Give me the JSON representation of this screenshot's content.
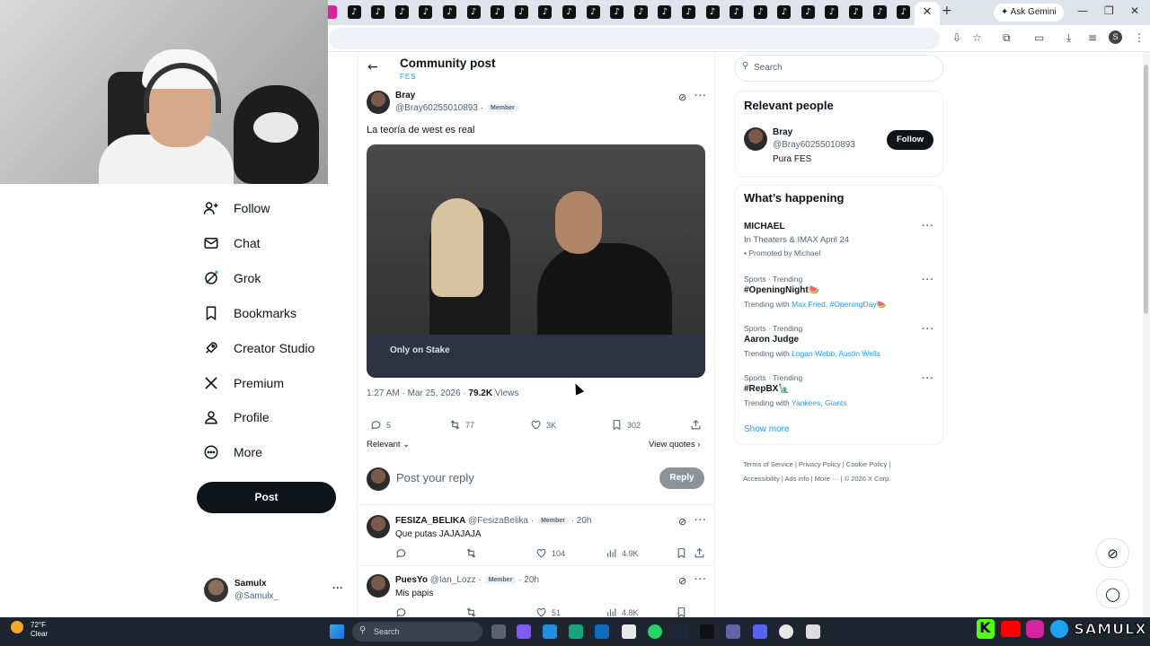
{
  "browser": {
    "gemini_label": "✦ Ask Gemini",
    "profile_initial": "S"
  },
  "sidebar": {
    "items": [
      {
        "label": "Follow",
        "icon": "follow-icon"
      },
      {
        "label": "Chat",
        "icon": "mail-icon"
      },
      {
        "label": "Grok",
        "icon": "grok-icon"
      },
      {
        "label": "Bookmarks",
        "icon": "bookmark-icon"
      },
      {
        "label": "Creator Studio",
        "icon": "rocket-icon"
      },
      {
        "label": "Premium",
        "icon": "x-logo-icon"
      },
      {
        "label": "Profile",
        "icon": "person-icon"
      },
      {
        "label": "More",
        "icon": "more-circle-icon"
      }
    ],
    "post_label": "Post",
    "account": {
      "name": "Samulx",
      "handle": "@Samulx_"
    }
  },
  "header": {
    "title": "Community post",
    "subtitle": "FES"
  },
  "post": {
    "author": "Bray",
    "handle": "@Bray60255010893 ·",
    "badge": "Member",
    "text": "La teoría de west es real",
    "media_label": "Only on Stake",
    "time": "1:27 AM · Mar 25, 2026 · ",
    "views_count": "79.2K",
    "views_label": " Views",
    "replies": "5",
    "reposts": "77",
    "likes": "3K",
    "bookmarks": "302",
    "sort_label": "Relevant",
    "quotes_label": "View quotes"
  },
  "reply_box": {
    "placeholder": "Post your reply",
    "button": "Reply"
  },
  "replies": [
    {
      "name": "FESIZA_BELIKA",
      "handle": "@FesizaBelika ·",
      "badge": "Member",
      "time": "· 20h",
      "text": "Que putas JAJAJAJA",
      "likes": "104",
      "views": "4.9K"
    },
    {
      "name": "PuesYo",
      "handle": "@Ian_Lozz ·",
      "badge": "Member",
      "time": "· 20h",
      "text": "Mis papis",
      "likes": "51",
      "views": "4.8K"
    }
  ],
  "right": {
    "search_placeholder": "Search",
    "relevant_title": "Relevant people",
    "person": {
      "name": "Bray",
      "handle": "@Bray60255010893",
      "bio": "Pura FES",
      "follow": "Follow"
    },
    "happening_title": "What’s happening",
    "promo": {
      "name": "MICHAEL",
      "line": "In Theaters & IMAX April 24",
      "promoted": "Promoted by Michael"
    },
    "trends": [
      {
        "cat": "Sports · Trending",
        "name": "#OpeningNight🍉",
        "with": "Trending with ",
        "links": "Max Fried, #OpeningDay🍉"
      },
      {
        "cat": "Sports · Trending",
        "name": "Aaron Judge",
        "with": "Trending with ",
        "links": "Logan Webb, Austin Wells"
      },
      {
        "cat": "Sports · Trending",
        "name": "#RepBX🗽",
        "with": "Trending with ",
        "links": "Yankees, Giants"
      }
    ],
    "show_more": "Show more",
    "footer": [
      "Terms of Service",
      "Privacy Policy",
      "Cookie Policy",
      "Accessibility",
      "Ads info",
      "More ···",
      "© 2026 X Corp."
    ]
  },
  "taskbar": {
    "temp": "72°F",
    "cond": "Clear",
    "search": "Search",
    "brand": "SAMULX"
  }
}
